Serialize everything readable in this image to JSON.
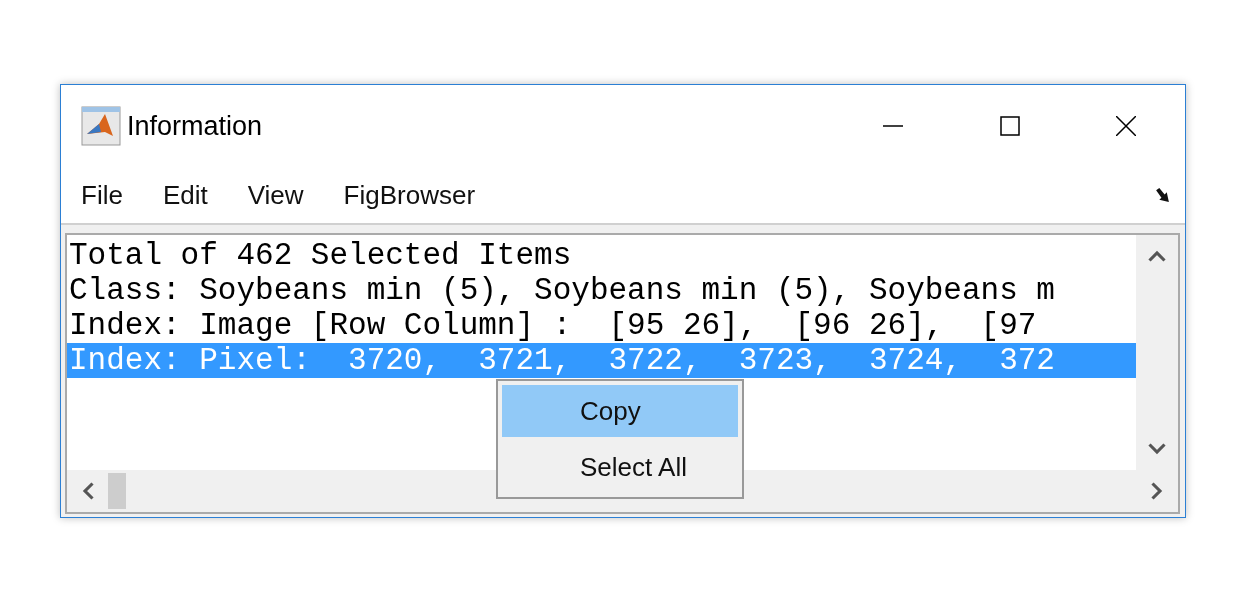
{
  "window": {
    "title": "Information"
  },
  "menu_bar": [
    "File",
    "Edit",
    "View",
    "FigBrowser"
  ],
  "lines": [
    {
      "text": "Total of 462 Selected Items",
      "selected": false
    },
    {
      "text": "Class: Soybeans min (5), Soybeans min (5), Soybeans m",
      "selected": false
    },
    {
      "text": "Index: Image [Row Column] :  [95 26],  [96 26],  [97",
      "selected": false
    },
    {
      "text": "Index: Pixel:  3720,  3721,  3722,  3723,  3724,  372",
      "selected": true
    }
  ],
  "context_menu": [
    {
      "label": "Copy",
      "highlighted": true
    },
    {
      "label": "Select All",
      "highlighted": false
    }
  ]
}
